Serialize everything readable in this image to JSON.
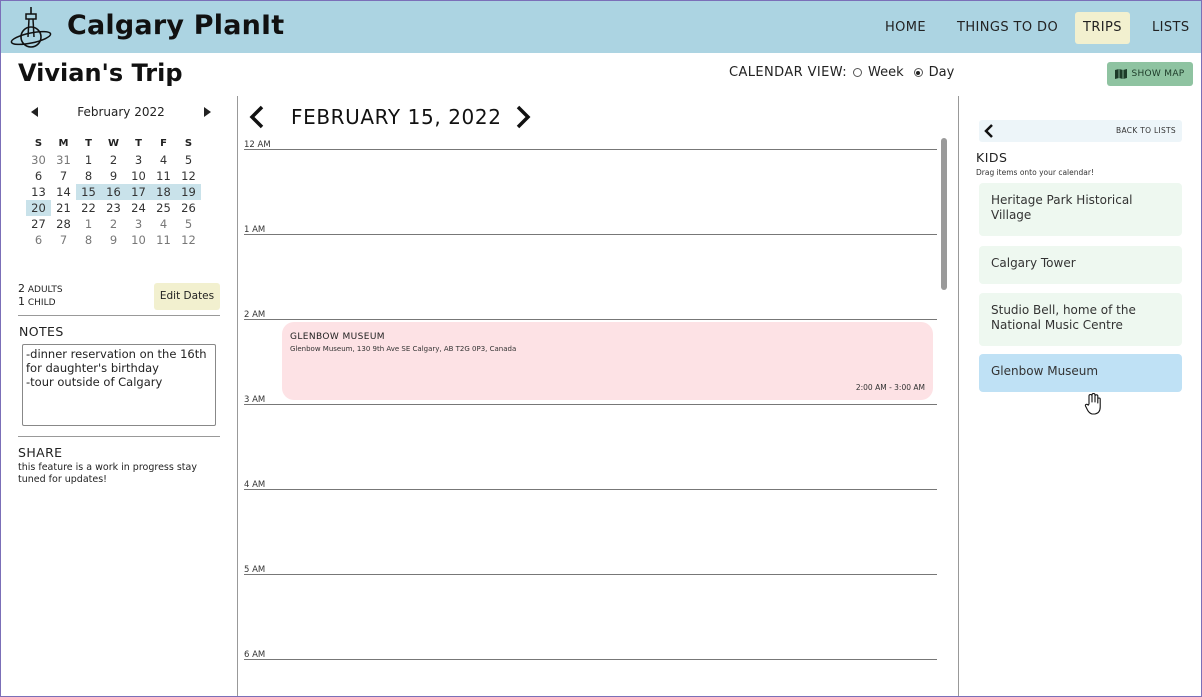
{
  "header": {
    "brand": "Calgary PlanIt",
    "logo_icon": "calgary-tower-planet-icon",
    "nav": [
      {
        "label": "HOME"
      },
      {
        "label": "THINGS TO DO"
      },
      {
        "label": "TRIPS",
        "active": true
      },
      {
        "label": "LISTS"
      }
    ]
  },
  "trip": {
    "title": "Vivian's Trip",
    "calendar_view_label": "CALENDAR VIEW:",
    "view_options": [
      {
        "label": "Week",
        "selected": false
      },
      {
        "label": "Day",
        "selected": true
      }
    ],
    "show_map_label": "SHOW MAP",
    "show_map_icon": "map-icon"
  },
  "mini_calendar": {
    "month_label": "February 2022",
    "weekdays": [
      "S",
      "M",
      "T",
      "W",
      "T",
      "F",
      "S"
    ],
    "weeks": [
      [
        "30",
        "31",
        "1",
        "2",
        "3",
        "4",
        "5"
      ],
      [
        "6",
        "7",
        "8",
        "9",
        "10",
        "11",
        "12"
      ],
      [
        "13",
        "14",
        "15",
        "16",
        "17",
        "18",
        "19"
      ],
      [
        "20",
        "21",
        "22",
        "23",
        "24",
        "25",
        "26"
      ],
      [
        "27",
        "28",
        "1",
        "2",
        "3",
        "4",
        "5"
      ],
      [
        "6",
        "7",
        "8",
        "9",
        "10",
        "11",
        "12"
      ]
    ],
    "highlight_color": "#c9e2ea"
  },
  "party": {
    "adults_count": "2",
    "adults_label": "ADULTS",
    "child_count": "1",
    "child_label": "CHILD",
    "edit_dates_label": "Edit Dates"
  },
  "notes": {
    "heading": "NOTES",
    "lines": [
      "-dinner reservation on the 16th",
      "for daughter's birthday",
      "-tour outside of Calgary"
    ]
  },
  "share": {
    "heading": "SHARE",
    "text": "this feature is a work in progress stay tuned for updates!"
  },
  "day_view": {
    "date_title": "FEBRUARY 15, 2022",
    "prev_icon": "chevron-left-icon",
    "next_icon": "chevron-right-icon",
    "hours": [
      "12 AM",
      "1 AM",
      "2 AM",
      "3 AM",
      "4 AM",
      "5 AM",
      "6 AM"
    ],
    "event": {
      "title": "GLENBOW MUSEUM",
      "address": "Glenbow Museum, 130 9th Ave SE Calgary, AB T2G 0P3, Canada",
      "time": "2:00 AM - 3:00 AM",
      "color": "#fde2e5"
    }
  },
  "list_panel": {
    "back_label": "BACK TO LISTS",
    "list_name": "KIDS",
    "hint": "Drag items onto your calendar!",
    "items": [
      {
        "label": "Heritage Park Historical Village"
      },
      {
        "label": "Calgary Tower"
      },
      {
        "label": "Studio Bell, home of the National Music Centre"
      },
      {
        "label": "Glenbow Museum",
        "dragging": true
      }
    ],
    "item_color": "#eef8f0",
    "active_item_color": "#bfe1f5",
    "cursor_icon": "grab-hand-icon"
  }
}
